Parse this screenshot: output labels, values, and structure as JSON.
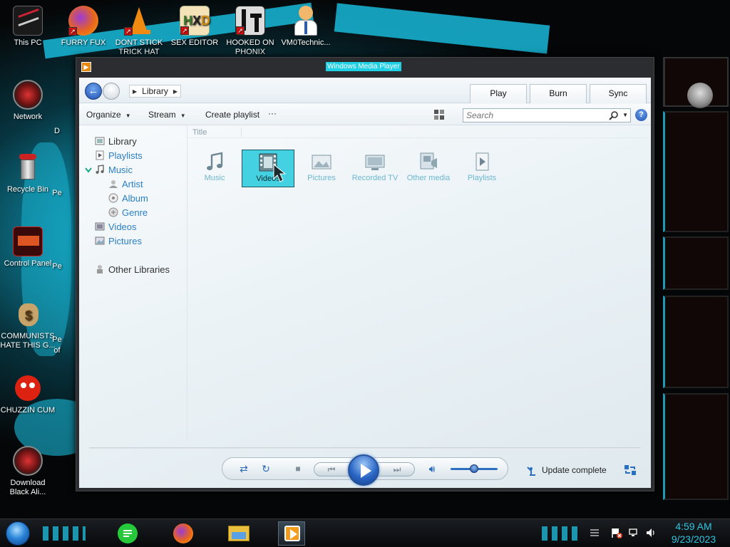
{
  "desktop": {
    "icons": [
      {
        "label": "This PC"
      },
      {
        "label": "FURRY FUX"
      },
      {
        "label": "DONT STICK TRICK HAT"
      },
      {
        "label": "SEX EDITOR"
      },
      {
        "label": "HOOKED ON PHONIX"
      },
      {
        "label": "VM0Technic..."
      },
      {
        "label": "Network"
      },
      {
        "label": "Recycle Bin"
      },
      {
        "label": "Control Panel"
      },
      {
        "label": "COMMUNISTS HATE THIS G..."
      },
      {
        "label": "CHUZZIN CUM"
      },
      {
        "label": "Download Black Ali..."
      }
    ],
    "partial_labels": [
      "D",
      "Pe",
      "Pe",
      "Pe",
      "of"
    ]
  },
  "window": {
    "title": "Windows Media Player"
  },
  "nav": {
    "breadcrumb": "Library"
  },
  "tabs": [
    {
      "label": "Play"
    },
    {
      "label": "Burn"
    },
    {
      "label": "Sync"
    }
  ],
  "toolbar": {
    "organize": "Organize",
    "stream": "Stream",
    "create_playlist": "Create playlist",
    "more": "···"
  },
  "search": {
    "placeholder": "Search"
  },
  "help": "?",
  "navpane": {
    "library": "Library",
    "playlists": "Playlists",
    "music": "Music",
    "artist": "Artist",
    "album": "Album",
    "genre": "Genre",
    "videos": "Videos",
    "pictures": "Pictures",
    "other_libraries": "Other Libraries"
  },
  "content": {
    "column_title": "Title",
    "tiles": [
      {
        "label": "Music",
        "icon": "music-note-icon"
      },
      {
        "label": "Videos",
        "icon": "film-icon",
        "selected": true
      },
      {
        "label": "Pictures",
        "icon": "picture-icon"
      },
      {
        "label": "Recorded TV",
        "icon": "tv-icon"
      },
      {
        "label": "Other media",
        "icon": "media-icon"
      },
      {
        "label": "Playlists",
        "icon": "playlist-icon"
      }
    ]
  },
  "player": {
    "status": "Update complete",
    "volume_level": 0.5
  },
  "taskbar": {
    "time": "4:59 AM",
    "date": "9/23/2023"
  },
  "colors": {
    "accent_cyan": "#1fd0e4",
    "selection": "#44d2e2",
    "link_blue": "#2a7fc4",
    "clock": "#2fc5e3"
  }
}
